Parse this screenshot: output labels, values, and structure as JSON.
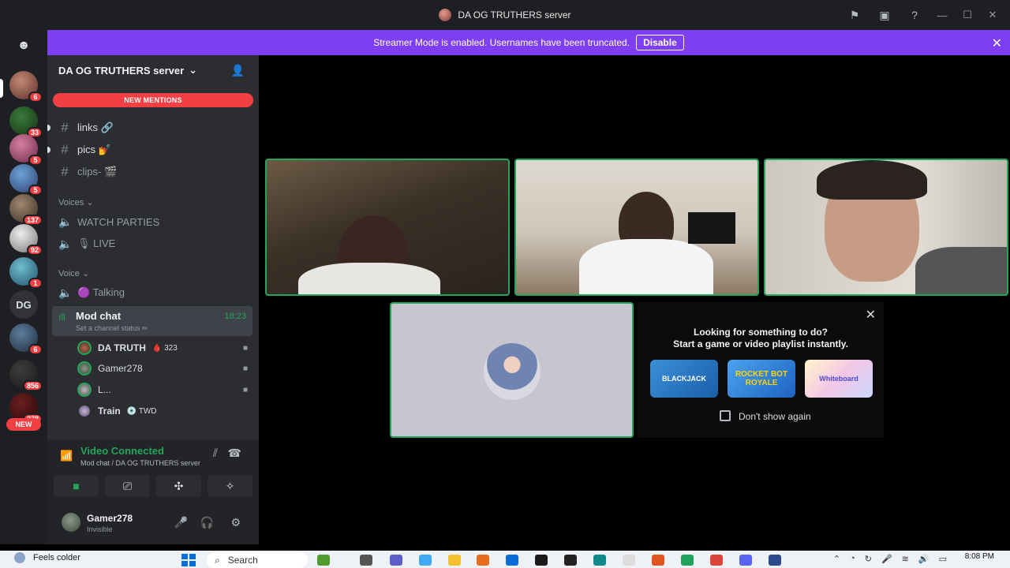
{
  "window": {
    "title": "DA OG TRUTHERS server"
  },
  "banner": {
    "message": "Streamer Mode is enabled. Usernames have been truncated.",
    "action": "Disable"
  },
  "rail": {
    "badges": [
      "6",
      "33",
      "5",
      "5",
      "137",
      "92",
      "1",
      "6",
      "856",
      "278"
    ],
    "dg_label": "DG",
    "new_label": "NEW"
  },
  "server": {
    "name": "DA OG TRUTHERS server",
    "new_mentions": "NEW MENTIONS"
  },
  "channels": {
    "text": [
      {
        "label": "links 🔗"
      },
      {
        "label": "pics 💅"
      },
      {
        "label": "clips- 🎬"
      }
    ],
    "category_voices": "Voices",
    "voices": [
      {
        "label": "WATCH PARTIES"
      },
      {
        "label": "🎙 LIVE"
      }
    ],
    "category_voice": "Voice",
    "voice": [
      {
        "label": "🟣 Talking"
      }
    ],
    "active": {
      "name": "Mod chat",
      "status": "Set a channel status ✏",
      "time": "18:23"
    },
    "members": [
      {
        "name": "DA TRUTH",
        "extra": "🩸 323"
      },
      {
        "name": "Gamer278",
        "extra": ""
      },
      {
        "name": "L...",
        "extra": ""
      },
      {
        "name": "Train",
        "extra": "💿 TWD"
      }
    ]
  },
  "voice_connected": {
    "title": "Video Connected",
    "subtitle": "Mod chat / DA OG TRUTHERS server"
  },
  "user": {
    "name": "Gamer278",
    "status": "Invisible"
  },
  "activity": {
    "line1": "Looking for something to do?",
    "line2": "Start a game or video playlist instantly.",
    "apps": [
      "BLACKJACK",
      "ROCKET BOT ROYALE",
      "Whiteboard"
    ],
    "checkbox_label": "Don't show again"
  },
  "taskbar": {
    "weather": "Feels colder",
    "search": "Search",
    "time": "8:08 PM"
  },
  "colors": {
    "banner": "#7e3ff2",
    "green": "#23a55a",
    "red_badge": "#f23f43"
  }
}
